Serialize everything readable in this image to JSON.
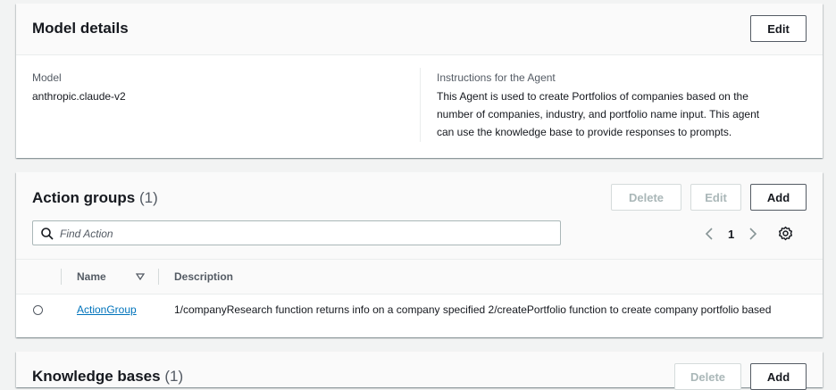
{
  "model_details": {
    "title": "Model details",
    "edit_label": "Edit",
    "model_label": "Model",
    "model_value": "anthropic.claude-v2",
    "instructions_label": "Instructions for the Agent",
    "instructions_lines": [
      "This Agent is used to create Portfolios of companies based on the",
      "number of companies, industry, and portfolio name input. This agent",
      "can use the knowledge base to provide responses to prompts."
    ]
  },
  "action_groups": {
    "title": "Action groups",
    "count": "(1)",
    "delete_label": "Delete",
    "edit_label": "Edit",
    "add_label": "Add",
    "search_placeholder": "Find Action",
    "page": "1",
    "columns": {
      "name": "Name",
      "description": "Description"
    },
    "rows": [
      {
        "name": "ActionGroup",
        "description": "1/companyResearch function returns info on a company specified 2/createPortfolio function to create company portfolio based"
      }
    ]
  },
  "knowledge_bases": {
    "title": "Knowledge bases",
    "count": "(1)",
    "delete_label": "Delete",
    "add_label": "Add"
  },
  "colors": {
    "link": "#0073bb",
    "text": "#16191f",
    "muted": "#545b64"
  },
  "icons": [
    "search-icon",
    "chevron-left-icon",
    "chevron-right-icon",
    "gear-icon",
    "sort-down-icon"
  ]
}
